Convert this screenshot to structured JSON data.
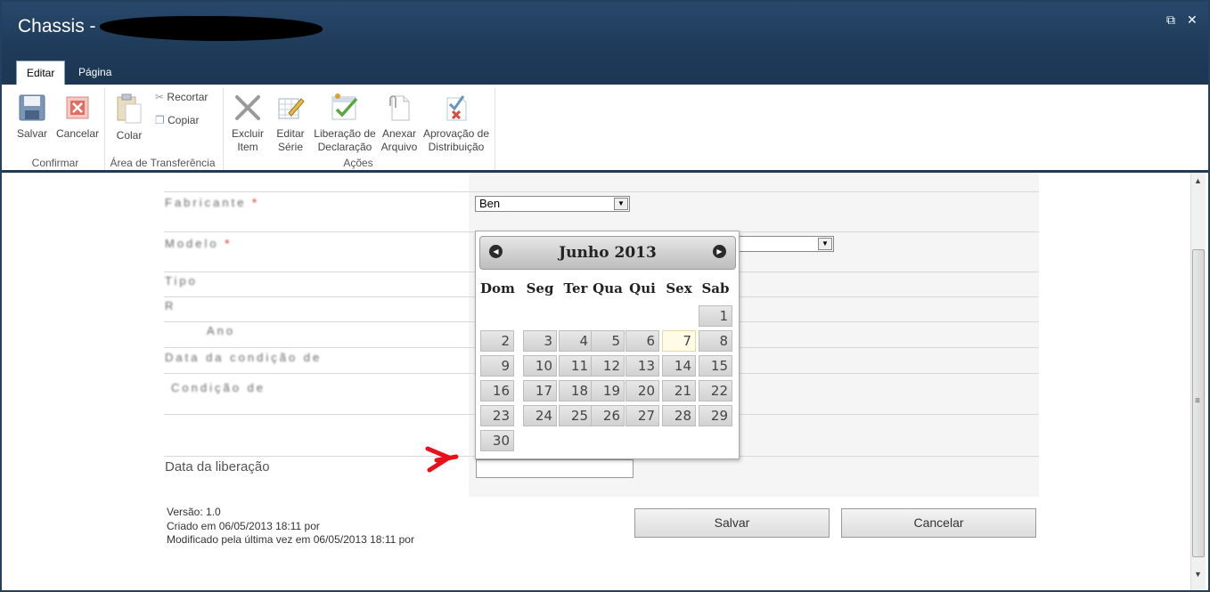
{
  "window": {
    "title": "Chassis - ",
    "restore_glyph": "⧉",
    "close_glyph": "✕"
  },
  "tabs": [
    {
      "label": "Editar"
    },
    {
      "label": "Página"
    }
  ],
  "ribbon": {
    "confirmar": {
      "salvar": "Salvar",
      "cancelar": "Cancelar",
      "group": "Confirmar"
    },
    "transferencia": {
      "colar": "Colar",
      "recortar": "Recortar",
      "copiar": "Copiar",
      "group": "Área de Transferência"
    },
    "acoes": {
      "excluir_1": "Excluir",
      "excluir_2": "Item",
      "editar_1": "Editar",
      "editar_2": "Série",
      "liberacao_1": "Liberação de",
      "liberacao_2": "Declaração",
      "anexar_1": "Anexar",
      "anexar_2": "Arquivo",
      "aprovacao_1": "Aprovação de",
      "aprovacao_2": "Distribuição",
      "group": "Ações"
    }
  },
  "form": {
    "fabricante_label": "Fabricante",
    "modelo_label": "Modelo",
    "tipo_label": "Tipo",
    "renavam_label": "R",
    "ano_label": "Ano",
    "data_label": "Data da condição de",
    "condicao_label": "Condição de",
    "required_mark": "*",
    "fabricante_value": "Ben",
    "select_arrow": "▼",
    "data_liberacao_label": "Data da liberação"
  },
  "calendar": {
    "month_title": "Junho 2013",
    "prev_glyph": "◀",
    "next_glyph": "▶",
    "weekdays": [
      "Dom",
      "Seg",
      "Ter",
      "Qua",
      "Qui",
      "Sex",
      "Sab"
    ],
    "first_weekday_index": 6,
    "days_in_month": 30,
    "highlighted_day": 7
  },
  "footer": {
    "versao": "Versão: 1.0",
    "criado": "Criado em 06/05/2013 18:11 por",
    "modificado": "Modificado pela última vez em 06/05/2013 18:11 por",
    "salvar": "Salvar",
    "cancelar": "Cancelar"
  },
  "scrollbar": {
    "up_glyph": "▲",
    "down_glyph": "▼",
    "grip_glyph": "≡"
  },
  "colors": {
    "titlebar": "#1f3b5a",
    "accent_arrow": "#e8101a",
    "required": "#cc0000"
  }
}
